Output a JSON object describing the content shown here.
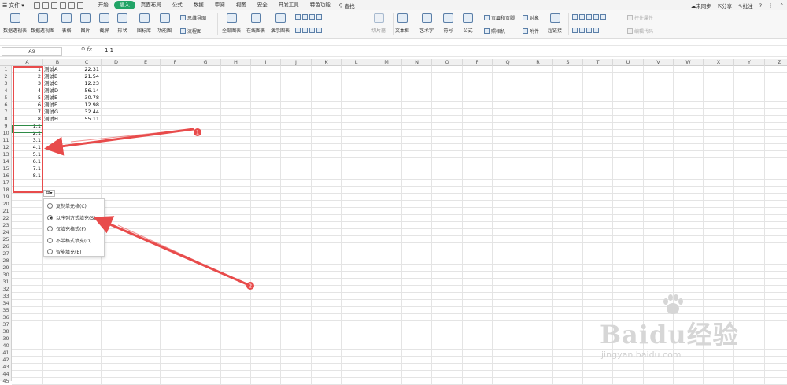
{
  "menubar": {
    "file": "文件",
    "tabs": [
      "开始",
      "插入",
      "页面布局",
      "公式",
      "数据",
      "审阅",
      "视图",
      "安全",
      "开发工具",
      "特色功能"
    ],
    "active_tab": "插入",
    "search": "查找",
    "right": {
      "sync": "未同步",
      "share": "分享",
      "comment": "批注",
      "help": "?"
    }
  },
  "ribbon": {
    "pivot_table": "数据透视表",
    "pivot_chart": "数据透视图",
    "table": "表格",
    "picture": "图片",
    "screenshot": "截屏",
    "shapes": "形状",
    "icon_lib": "图标库",
    "func_chart": "功能图",
    "mind_map": "思维导图",
    "flowchart": "流程图",
    "all_charts": "全部图表",
    "online_charts": "在线图表",
    "demo_charts": "演示图表",
    "slicer": "切片器",
    "textbox": "文本框",
    "wordart": "艺术字",
    "symbol": "符号",
    "formula": "公式",
    "header_footer": "页眉和页脚",
    "object": "对象",
    "camera": "照相机",
    "attachment": "附件",
    "hyperlink": "超链接",
    "control_props": "控件属性",
    "edit_code": "编辑代码"
  },
  "formula_bar": {
    "name_box": "A9",
    "fx": "fx",
    "value": "1.1"
  },
  "columns": [
    "A",
    "B",
    "C",
    "D",
    "E",
    "F",
    "G",
    "H",
    "I",
    "J",
    "K",
    "L",
    "M",
    "N",
    "O",
    "P",
    "Q",
    "R",
    "S",
    "T",
    "U",
    "V",
    "W",
    "X",
    "Y",
    "Z"
  ],
  "rows": [
    "1",
    "2",
    "3",
    "4",
    "5",
    "6",
    "7",
    "8",
    "9",
    "10",
    "11",
    "12",
    "13",
    "14",
    "15",
    "16",
    "17",
    "18",
    "19",
    "20",
    "21",
    "22",
    "23",
    "24",
    "25",
    "26",
    "27",
    "28",
    "29",
    "30",
    "31",
    "32",
    "33",
    "34",
    "35",
    "36",
    "37",
    "38",
    "39",
    "40",
    "41",
    "42",
    "43",
    "44",
    "45"
  ],
  "cells": {
    "colA": [
      "1",
      "2",
      "3",
      "4",
      "5",
      "6",
      "7",
      "8",
      "1.1",
      "2.1",
      "3.1",
      "4.1",
      "5.1",
      "6.1",
      "7.1",
      "8.1"
    ],
    "colB": [
      "测试A",
      "测试B",
      "测试C",
      "测试D",
      "测试E",
      "测试F",
      "测试G",
      "测试H"
    ],
    "colC": [
      "22.31",
      "21.54",
      "12.23",
      "56.14",
      "30.78",
      "12.98",
      "32.44",
      "55.11"
    ]
  },
  "autofill_menu": {
    "button": "⊞▾",
    "options": [
      "复制单元格(C)",
      "以序列方式填充(S)",
      "仅填充格式(F)",
      "不带格式填充(O)",
      "智能填充(E)"
    ],
    "selected_index": 1
  },
  "annotations": {
    "marker1": "1",
    "marker2": "2",
    "color": "#e84b4b"
  },
  "watermark": {
    "main": "Baidu经验",
    "sub": "jingyan.baidu.com"
  }
}
